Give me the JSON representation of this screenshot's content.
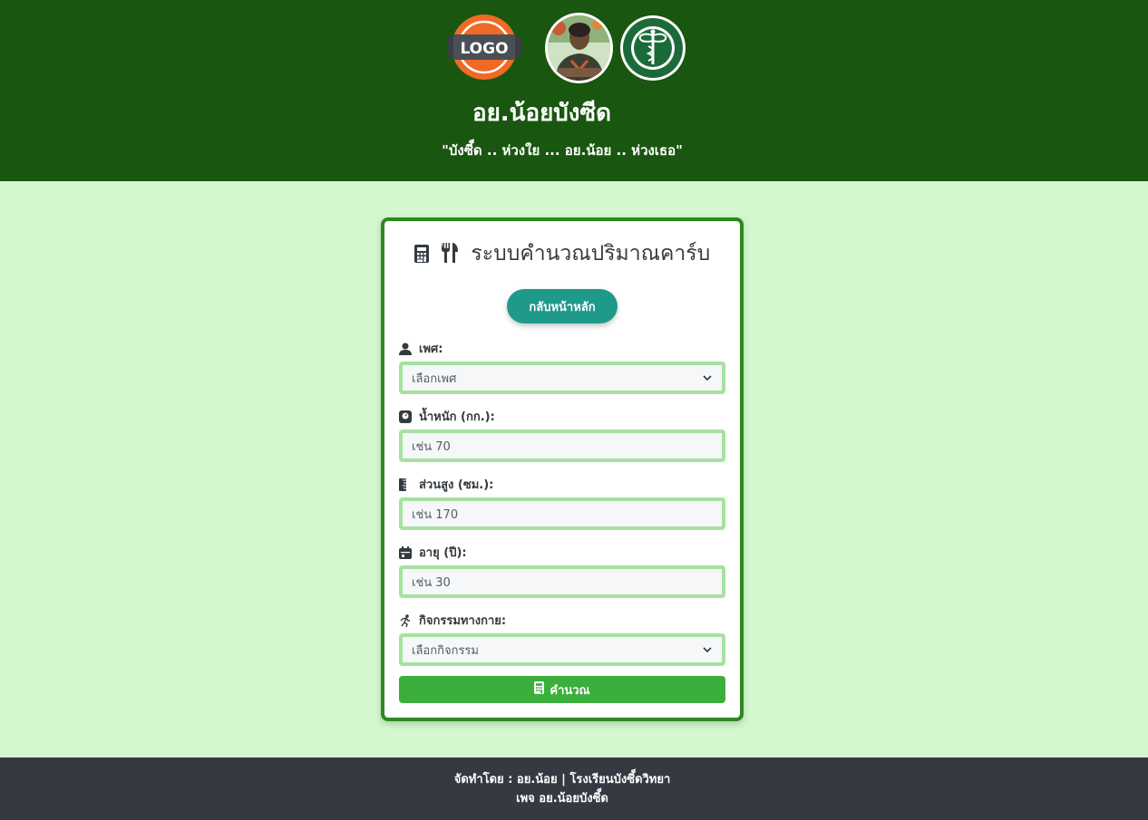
{
  "header": {
    "logo_text": "LOGO",
    "site_title": "อย.น้อยบังซีด",
    "slogan": "\"บังซี็ด .. ห่วงใย ... อย.น้อย .. ห่วงเธอ\"",
    "colors": {
      "header_bg": "#19560f",
      "logo_orange": "#f06a25",
      "moph_green": "#1b6b3a"
    }
  },
  "card": {
    "title": "ระบบคำนวณปริมาณคาร์บ",
    "title_icons": [
      "calculator-icon",
      "utensils-icon"
    ],
    "home_button": "กลับหน้าหลัก",
    "fields": {
      "gender": {
        "label": "เพศ:",
        "icon": "user-icon",
        "value": "เลือกเพศ"
      },
      "weight": {
        "label": "น้ำหนัก (กก.):",
        "icon": "weight-scale-icon",
        "placeholder": "เช่น 70"
      },
      "height": {
        "label": "ส่วนสูง (ซม.):",
        "icon": "ruler-icon",
        "placeholder": "เช่น 170"
      },
      "age": {
        "label": "อายุ (ปี):",
        "icon": "calendar-icon",
        "placeholder": "เช่น 30"
      },
      "activity": {
        "label": "กิจกรรมทางกาย:",
        "icon": "running-icon",
        "value": "เลือกกิจกรรม"
      }
    },
    "calculate_button": "คำนวณ",
    "colors": {
      "border": "#2b8a1e",
      "field_border": "#a6e1a0",
      "home_btn": "#1f998a",
      "calc_btn": "#3cae3b"
    }
  },
  "footer": {
    "line1": "จัดทำโดย : อย.น้อย | โรงเรียนบังซี็ดวิทยา",
    "line2": "เพจ อย.น้อยบังซี็ด",
    "colors": {
      "bg": "#353a42"
    }
  },
  "page": {
    "bg": "#d4f7d0"
  }
}
